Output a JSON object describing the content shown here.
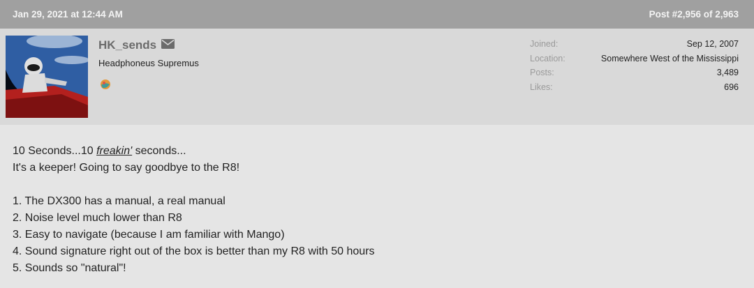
{
  "header": {
    "date": "Jan 29, 2021 at 12:44 AM",
    "post_number": "Post #2,956 of 2,963"
  },
  "user": {
    "name": "HK_sends",
    "title": "Headphoneus Supremus",
    "stats": [
      {
        "label": "Joined:",
        "value": "Sep 12, 2007"
      },
      {
        "label": "Location:",
        "value": "Somewhere West of the Mississippi"
      },
      {
        "label": "Posts:",
        "value": "3,489"
      },
      {
        "label": "Likes:",
        "value": "696"
      }
    ]
  },
  "post": {
    "line1_a": "10 Seconds...10 ",
    "line1_em": "freakin'",
    "line1_b": " seconds...",
    "line2": "It's a keeper! Going to say goodbye to the R8!",
    "list": [
      "1. The DX300 has a manual, a real manual",
      "2. Noise level much lower than R8",
      "3. Easy to navigate (because I am familiar with Mango)",
      "4. Sound signature right out of the box is better than my R8 with 50 hours",
      "5. Sounds so \"natural\"!"
    ]
  }
}
